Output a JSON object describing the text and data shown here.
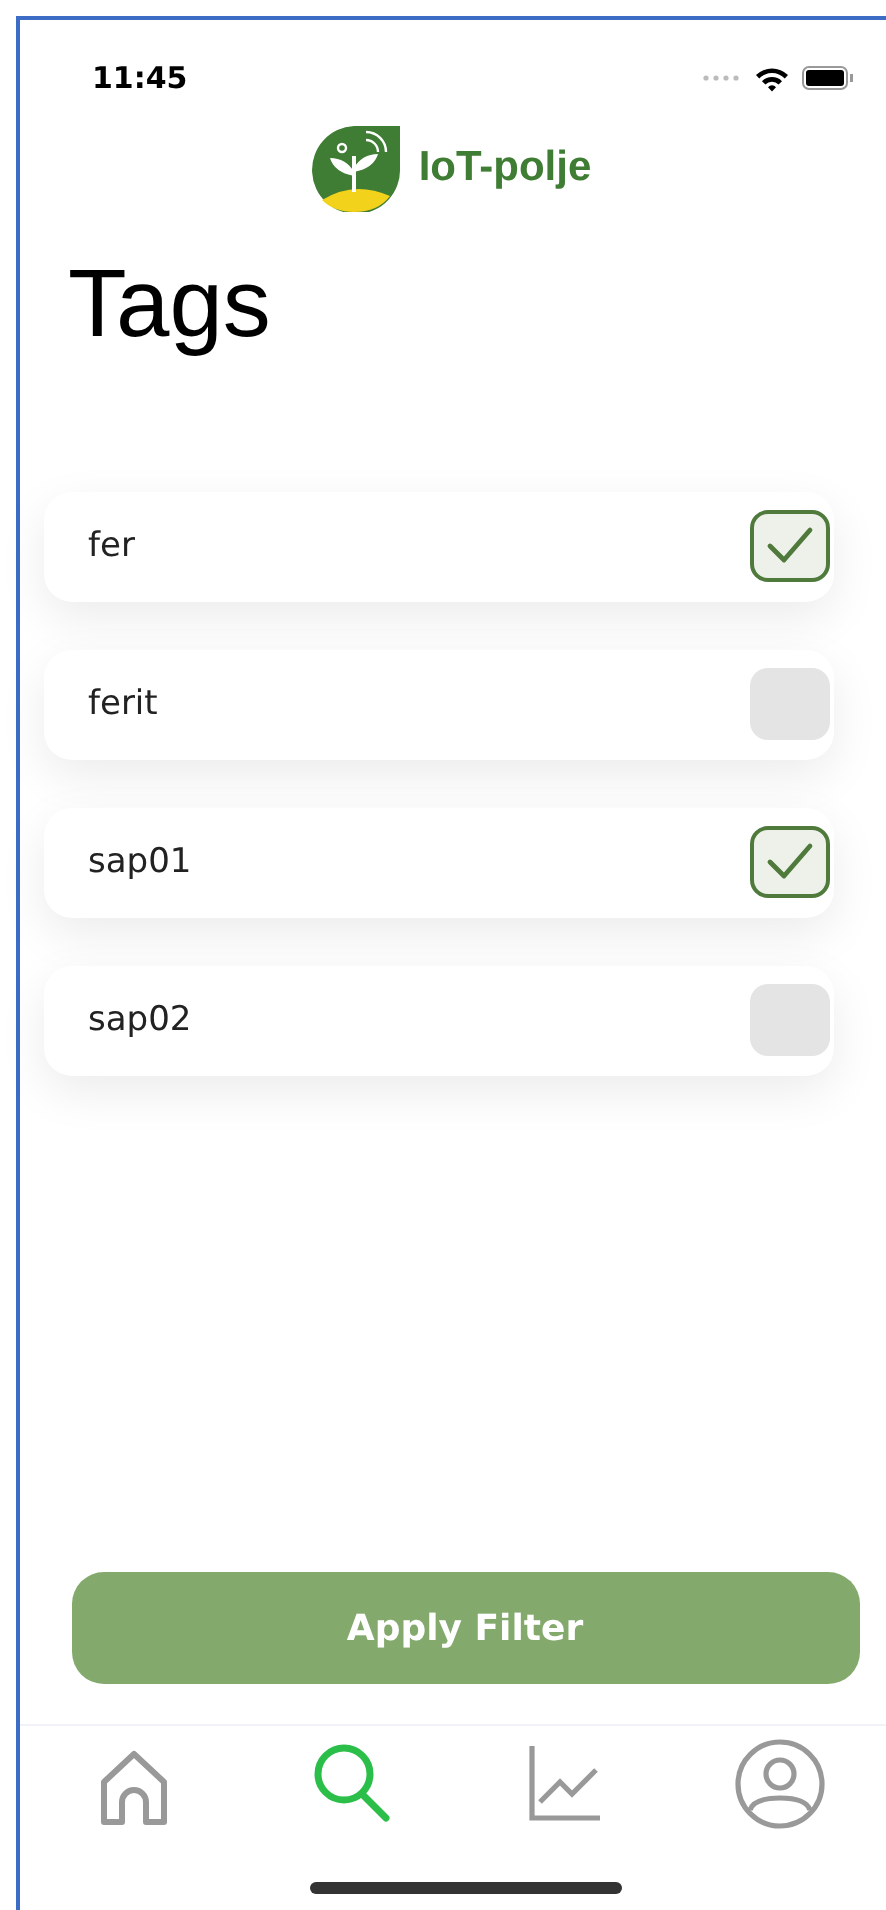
{
  "status_bar": {
    "time": "11:45"
  },
  "logo": {
    "text": "IoT-polje"
  },
  "title": "Tags",
  "tags": [
    {
      "label": "fer",
      "checked": true
    },
    {
      "label": "ferit",
      "checked": false
    },
    {
      "label": "sap01",
      "checked": true
    },
    {
      "label": "sap02",
      "checked": false
    }
  ],
  "apply_button": "Apply Filter",
  "tab_bar": [
    {
      "kind": "home",
      "selected": false
    },
    {
      "kind": "search",
      "selected": true
    },
    {
      "kind": "chart",
      "selected": false
    },
    {
      "kind": "profile",
      "selected": false
    }
  ]
}
